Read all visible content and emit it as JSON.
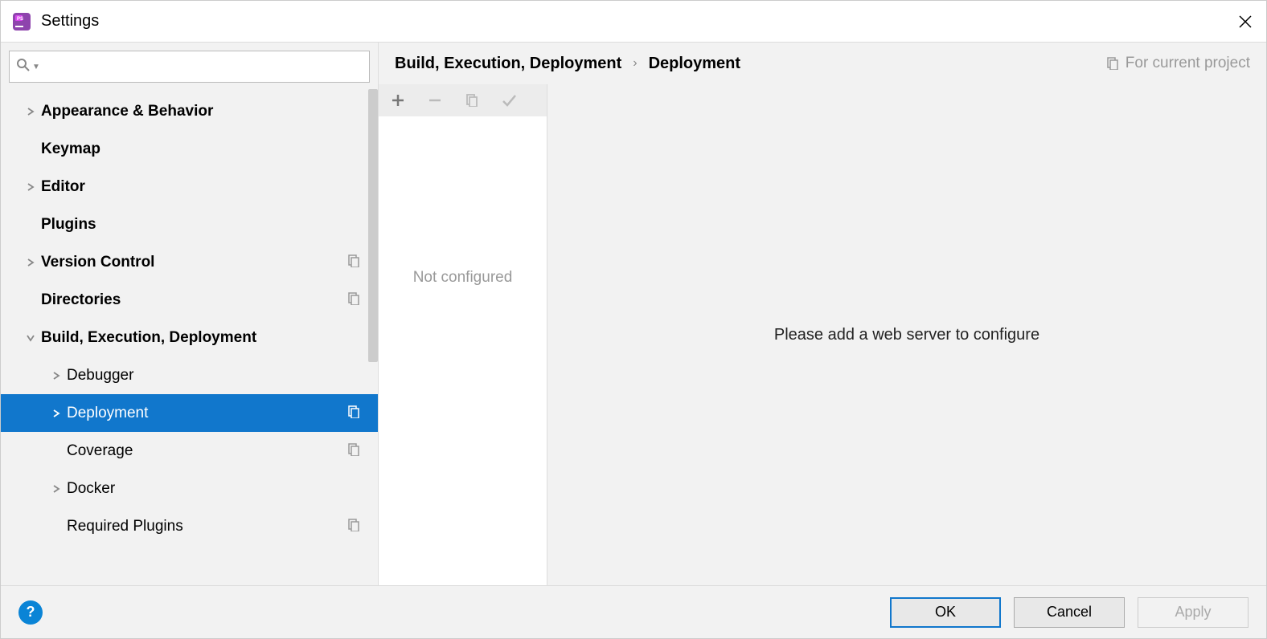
{
  "titlebar": {
    "title": "Settings"
  },
  "sidebar": {
    "search_placeholder": "",
    "items": [
      {
        "label": "Appearance & Behavior",
        "bold": true,
        "chevron": "right",
        "indent": 0,
        "proj": false
      },
      {
        "label": "Keymap",
        "bold": true,
        "chevron": "none",
        "indent": 0,
        "proj": false
      },
      {
        "label": "Editor",
        "bold": true,
        "chevron": "right",
        "indent": 0,
        "proj": false
      },
      {
        "label": "Plugins",
        "bold": true,
        "chevron": "none",
        "indent": 0,
        "proj": false
      },
      {
        "label": "Version Control",
        "bold": true,
        "chevron": "right",
        "indent": 0,
        "proj": true
      },
      {
        "label": "Directories",
        "bold": true,
        "chevron": "none",
        "indent": 0,
        "proj": true
      },
      {
        "label": "Build, Execution, Deployment",
        "bold": true,
        "chevron": "down",
        "indent": 0,
        "proj": false
      },
      {
        "label": "Debugger",
        "bold": false,
        "chevron": "right",
        "indent": 1,
        "proj": false
      },
      {
        "label": "Deployment",
        "bold": false,
        "chevron": "right",
        "indent": 1,
        "proj": true,
        "selected": true
      },
      {
        "label": "Coverage",
        "bold": false,
        "chevron": "none",
        "indent": 1,
        "proj": true
      },
      {
        "label": "Docker",
        "bold": false,
        "chevron": "right",
        "indent": 1,
        "proj": false
      },
      {
        "label": "Required Plugins",
        "bold": false,
        "chevron": "none",
        "indent": 1,
        "proj": true
      }
    ]
  },
  "content": {
    "breadcrumb_parent": "Build, Execution, Deployment",
    "breadcrumb_current": "Deployment",
    "scope_label": "For current project",
    "server_list_empty": "Not configured",
    "detail_empty": "Please add a web server to configure"
  },
  "footer": {
    "ok": "OK",
    "cancel": "Cancel",
    "apply": "Apply"
  }
}
